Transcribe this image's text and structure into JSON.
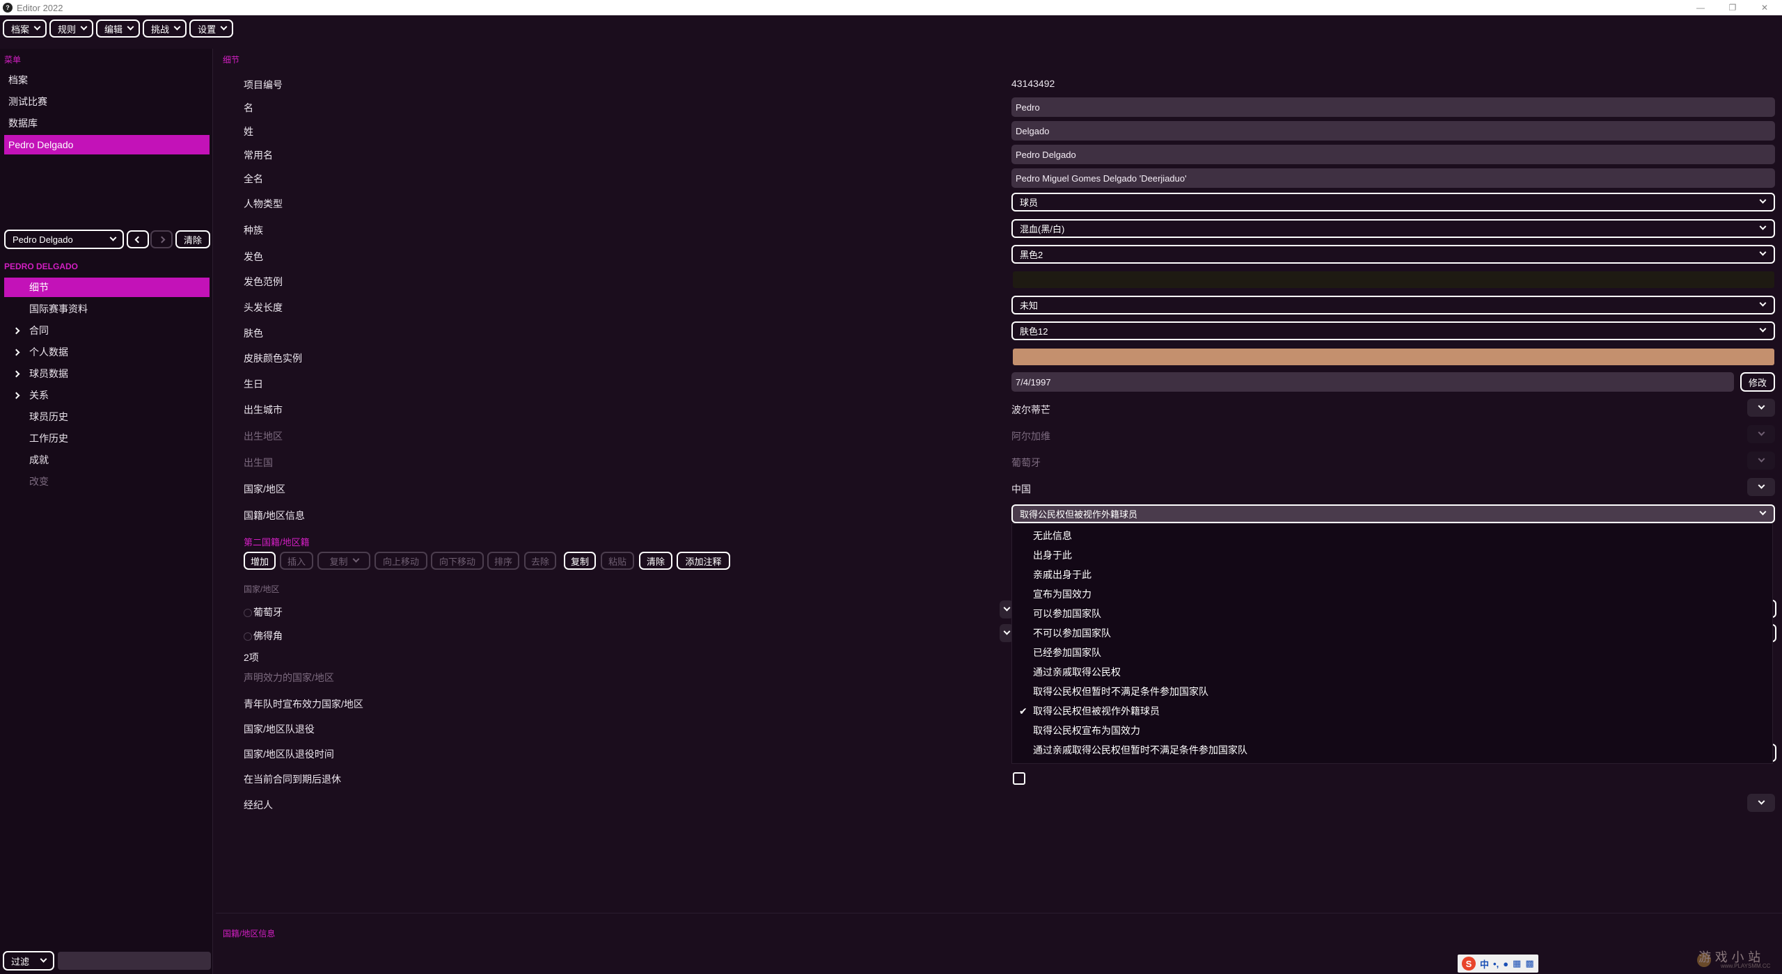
{
  "window": {
    "title": "Editor 2022"
  },
  "menubar": [
    "档案",
    "规则",
    "编辑",
    "挑战",
    "设置"
  ],
  "sidebar": {
    "menu_label": "菜单",
    "menu_items": [
      "档案",
      "测试比赛",
      "数据库",
      "Pedro Delgado"
    ],
    "person_select": "Pedro Delgado",
    "clear_label": "清除",
    "person_header": "PEDRO DELGADO",
    "sections": [
      {
        "label": "细节",
        "expandable": false,
        "active": true
      },
      {
        "label": "国际赛事资料",
        "expandable": false
      },
      {
        "label": "合同",
        "expandable": true
      },
      {
        "label": "个人数据",
        "expandable": true
      },
      {
        "label": "球员数据",
        "expandable": true
      },
      {
        "label": "关系",
        "expandable": true
      },
      {
        "label": "球员历史",
        "expandable": false
      },
      {
        "label": "工作历史",
        "expandable": false
      },
      {
        "label": "成就",
        "expandable": false
      },
      {
        "label": "改变",
        "expandable": false,
        "dim": true
      }
    ],
    "filter_label": "过滤"
  },
  "main": {
    "section_title": "细节",
    "fields": {
      "id": {
        "label": "项目编号",
        "value": "43143492"
      },
      "first_name": {
        "label": "名",
        "value": "Pedro"
      },
      "last_name": {
        "label": "姓",
        "value": "Delgado"
      },
      "common_name": {
        "label": "常用名",
        "value": "Pedro Delgado"
      },
      "full_name": {
        "label": "全名",
        "value": "Pedro Miguel Gomes Delgado 'Deerjiaduo'"
      },
      "person_type": {
        "label": "人物类型",
        "value": "球员"
      },
      "ethnicity": {
        "label": "种族",
        "value": "混血(黑/白)"
      },
      "hair_color": {
        "label": "发色",
        "value": "黑色2"
      },
      "hair_sample": {
        "label": "发色范例",
        "color": "#1e1a12"
      },
      "hair_length": {
        "label": "头发长度",
        "value": "未知"
      },
      "skin_tone": {
        "label": "肤色",
        "value": "肤色12"
      },
      "skin_sample": {
        "label": "皮肤颜色实例",
        "color": "#c4906e"
      },
      "birthday": {
        "label": "生日",
        "value": "7/4/1997",
        "button": "修改"
      },
      "birth_city": {
        "label": "出生城市",
        "value": "波尔蒂芒"
      },
      "birth_region": {
        "label": "出生地区",
        "value": "阿尔加维"
      },
      "birth_country": {
        "label": "出生国",
        "value": "葡萄牙"
      },
      "nation": {
        "label": "国家/地区",
        "value": "中国"
      },
      "nationality_info": {
        "label": "国籍/地区信息",
        "value": "取得公民权但被视作外籍球员"
      }
    },
    "second_nationality": {
      "title": "第二国籍/地区籍",
      "toolbar": [
        {
          "label": "增加",
          "enabled": true
        },
        {
          "label": "插入",
          "enabled": false
        },
        {
          "label": "复制",
          "enabled": false,
          "dropdown": true
        },
        {
          "label": "向上移动",
          "enabled": false
        },
        {
          "label": "向下移动",
          "enabled": false
        },
        {
          "label": "排序",
          "enabled": false
        },
        {
          "label": "去除",
          "enabled": false
        },
        {
          "label": "复制",
          "enabled": true
        },
        {
          "label": "粘贴",
          "enabled": false
        },
        {
          "label": "清除",
          "enabled": true
        },
        {
          "label": "添加注释",
          "enabled": true
        }
      ],
      "column_header": "国家/地区",
      "items": [
        "葡萄牙",
        "佛得角"
      ],
      "count": "2项"
    },
    "more_fields": {
      "declared": {
        "label": "声明效力的国家/地区"
      },
      "youth_declared": {
        "label": "青年队时宣布效力国家/地区"
      },
      "intl_retired": {
        "label": "国家/地区队退役"
      },
      "intl_retired_date": {
        "label": "国家/地区队退役时间"
      },
      "retire_after_contract": {
        "label": "在当前合同到期后退休"
      },
      "agent": {
        "label": "经纪人"
      }
    },
    "dropdown_options": [
      "无此信息",
      "出身于此",
      "亲戚出身于此",
      "宣布为国效力",
      "可以参加国家队",
      "不可以参加国家队",
      "已经参加国家队",
      "通过亲戚取得公民权",
      "取得公民权但暂时不满足条件参加国家队",
      "取得公民权但被视作外籍球员",
      "取得公民权宣布为国效力",
      "通过亲戚取得公民权但暂时不满足条件参加国家队"
    ],
    "dropdown_selected_index": 9,
    "footer_label": "国籍/地区信息"
  },
  "taskbar": {
    "ime_label": "中",
    "watermark": "游 戏 小 站",
    "watermark_sub": "www.PLAYSMM.CC"
  },
  "colors": {
    "accent": "#c312b8",
    "background": "#1b0d1d",
    "field": "#3f3042"
  }
}
